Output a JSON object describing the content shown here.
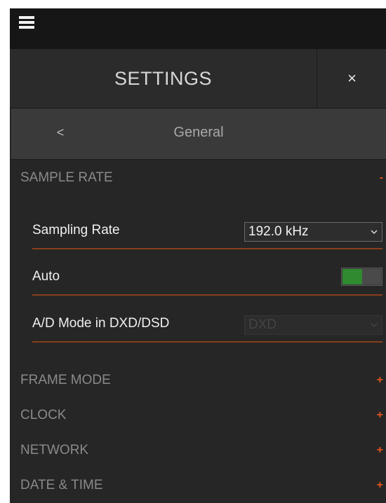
{
  "header": {
    "title": "SETTINGS",
    "close_label": "×"
  },
  "subheader": {
    "back_label": "<",
    "title": "General"
  },
  "sections": {
    "sample_rate": {
      "label": "SAMPLE RATE",
      "toggle": "-",
      "rows": {
        "sampling_rate": {
          "label": "Sampling Rate",
          "value": "192.0 kHz"
        },
        "auto": {
          "label": "Auto",
          "state": "on"
        },
        "ad_mode": {
          "label": "A/D Mode in DXD/DSD",
          "value": "DXD",
          "disabled": true
        }
      }
    },
    "frame_mode": {
      "label": "FRAME MODE",
      "toggle": "+"
    },
    "clock": {
      "label": "CLOCK",
      "toggle": "+"
    },
    "network": {
      "label": "NETWORK",
      "toggle": "+"
    },
    "date_time": {
      "label": "DATE & TIME",
      "toggle": "+"
    }
  },
  "colors": {
    "accent": "#e0531f",
    "toggle_on": "#2f8a30",
    "background": "#262626"
  },
  "icons": {
    "menu": "hamburger-icon",
    "close": "close-icon",
    "back": "chevron-left-icon",
    "dropdown": "chevron-down-icon"
  }
}
